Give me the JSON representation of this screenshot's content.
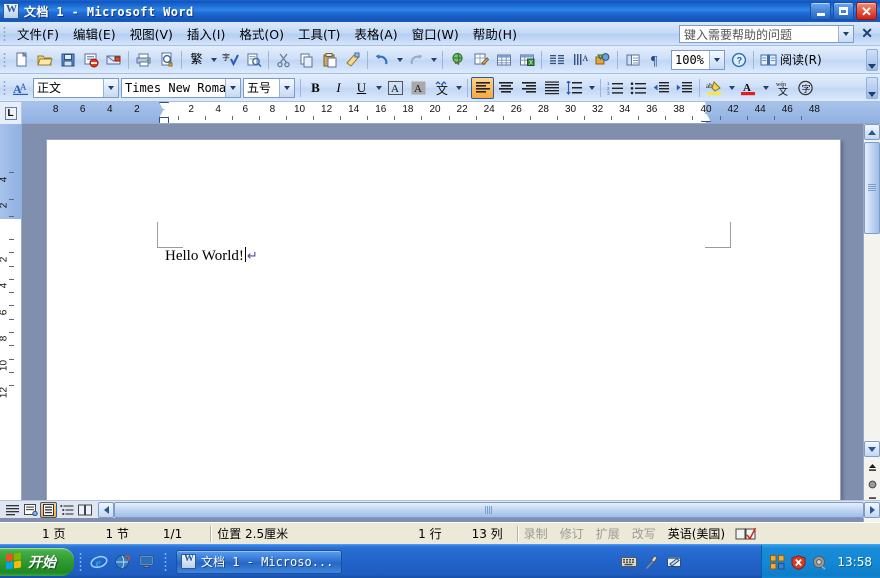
{
  "window": {
    "title": "文档 1 - Microsoft Word",
    "icon": "word-document-icon",
    "minimize_label": "最小化",
    "maximize_label": "最大化",
    "close_label": "关闭"
  },
  "menubar": {
    "items": [
      {
        "label": "文件(F)",
        "name": "menu-file"
      },
      {
        "label": "编辑(E)",
        "name": "menu-edit"
      },
      {
        "label": "视图(V)",
        "name": "menu-view"
      },
      {
        "label": "插入(I)",
        "name": "menu-insert"
      },
      {
        "label": "格式(O)",
        "name": "menu-format"
      },
      {
        "label": "工具(T)",
        "name": "menu-tools"
      },
      {
        "label": "表格(A)",
        "name": "menu-table"
      },
      {
        "label": "窗口(W)",
        "name": "menu-window"
      },
      {
        "label": "帮助(H)",
        "name": "menu-help"
      }
    ],
    "help_box_placeholder": "键入需要帮助的问题",
    "help_box_value": "",
    "close_label": "✕"
  },
  "standard_toolbar": {
    "buttons": [
      {
        "name": "new-document-icon",
        "glyph": "📄",
        "tooltip": "新建空白文档"
      },
      {
        "name": "open-folder-icon",
        "glyph": "📂",
        "tooltip": "打开"
      },
      {
        "name": "save-icon",
        "glyph": "💾",
        "tooltip": "保存"
      },
      {
        "name": "permission-icon",
        "glyph": "🚫",
        "tooltip": "权限"
      },
      {
        "name": "email-icon",
        "glyph": "✉",
        "tooltip": "电子邮件"
      },
      {
        "name": "print-icon",
        "glyph": "🖨",
        "tooltip": "打印"
      },
      {
        "name": "print-preview-icon",
        "glyph": "🔍",
        "tooltip": "打印预览"
      },
      {
        "name": "traditional-chinese-icon",
        "glyph": "繁",
        "tooltip": "简繁转换"
      },
      {
        "name": "spelling-check-icon",
        "glyph": "字",
        "tooltip": "拼写和语法"
      },
      {
        "name": "research-icon",
        "glyph": "📑",
        "tooltip": "信息检索"
      },
      {
        "name": "cut-icon",
        "glyph": "✂",
        "tooltip": "剪切"
      },
      {
        "name": "copy-icon",
        "glyph": "⧉",
        "tooltip": "复制"
      },
      {
        "name": "paste-icon",
        "glyph": "📋",
        "tooltip": "粘贴"
      },
      {
        "name": "format-painter-icon",
        "glyph": "🖌",
        "tooltip": "格式刷"
      },
      {
        "name": "undo-icon",
        "glyph": "↶",
        "tooltip": "撤消"
      },
      {
        "name": "redo-icon",
        "glyph": "↷",
        "tooltip": "恢复"
      },
      {
        "name": "hyperlink-icon",
        "glyph": "🌐",
        "tooltip": "插入超链接"
      },
      {
        "name": "tables-borders-icon",
        "glyph": "▦",
        "tooltip": "表格和边框"
      },
      {
        "name": "insert-table-icon",
        "glyph": "▤",
        "tooltip": "插入表格"
      },
      {
        "name": "insert-excel-icon",
        "glyph": "▩",
        "tooltip": "插入 Excel 电子表格"
      },
      {
        "name": "columns-icon",
        "glyph": "▥",
        "tooltip": "分栏"
      },
      {
        "name": "vertical-text-icon",
        "glyph": "⇅",
        "tooltip": "更改文字方向"
      },
      {
        "name": "drawing-icon",
        "glyph": "◩",
        "tooltip": "绘图"
      },
      {
        "name": "document-map-icon",
        "glyph": "▣",
        "tooltip": "文档结构图"
      },
      {
        "name": "show-hide-marks-icon",
        "glyph": "¶",
        "tooltip": "显示/隐藏编辑标记"
      }
    ],
    "zoom_value": "100%",
    "help_button": "help-icon",
    "reading_label": "阅读(R)",
    "toolbar_options_label": "工具栏选项"
  },
  "formatting_toolbar": {
    "styles_icon": "styles-and-formatting-icon",
    "style_value": "正文",
    "font_value": "Times New Roman",
    "size_value": "五号",
    "buttons": [
      {
        "name": "bold-button",
        "glyph": "B",
        "active": false
      },
      {
        "name": "italic-button",
        "glyph": "I",
        "active": false
      },
      {
        "name": "underline-button",
        "glyph": "U",
        "active": false
      },
      {
        "name": "character-border-button",
        "glyph": "A",
        "active": false
      },
      {
        "name": "character-shading-button",
        "glyph": "A",
        "active": false
      },
      {
        "name": "phonetic-guide-button",
        "glyph": "文",
        "active": false
      },
      {
        "name": "align-left-button",
        "glyph": "≡",
        "active": true
      },
      {
        "name": "align-center-button",
        "glyph": "≡",
        "active": false
      },
      {
        "name": "align-right-button",
        "glyph": "≡",
        "active": false
      },
      {
        "name": "distributed-button",
        "glyph": "≣",
        "active": false
      },
      {
        "name": "line-spacing-button",
        "glyph": "↕",
        "active": false
      },
      {
        "name": "numbered-list-button",
        "glyph": "1.",
        "active": false
      },
      {
        "name": "bulleted-list-button",
        "glyph": "•",
        "active": false
      },
      {
        "name": "decrease-indent-button",
        "glyph": "◀",
        "active": false
      },
      {
        "name": "increase-indent-button",
        "glyph": "▶",
        "active": false
      },
      {
        "name": "highlight-button",
        "glyph": "ab",
        "active": false
      },
      {
        "name": "font-color-button",
        "glyph": "A",
        "active": false
      },
      {
        "name": "translate-button",
        "glyph": "文",
        "active": false
      },
      {
        "name": "enclose-character-button",
        "glyph": "字",
        "active": false
      }
    ],
    "toolbar_options_label": "工具栏选项"
  },
  "ruler": {
    "tab_stop_marker": "L",
    "horizontal_left_numbers": [
      "8",
      "6",
      "4",
      "2"
    ],
    "horizontal_numbers": [
      "2",
      "4",
      "6",
      "8",
      "10",
      "12",
      "14",
      "16",
      "18",
      "20",
      "22",
      "24",
      "26",
      "28",
      "30",
      "32",
      "34",
      "36",
      "38",
      "40",
      "42",
      "44",
      "46",
      "48"
    ],
    "vertical_margin_numbers": [
      "4",
      "2"
    ],
    "vertical_numbers": [
      "2",
      "4",
      "6",
      "8",
      "10",
      "12"
    ],
    "unit": "厘米"
  },
  "document": {
    "text": "Hello World!",
    "paragraph_mark": "↵",
    "cursor_visible": true
  },
  "view_buttons": [
    {
      "name": "normal-view-button",
      "label": "普通视图",
      "active": false
    },
    {
      "name": "web-layout-view-button",
      "label": "Web 版式视图",
      "active": false
    },
    {
      "name": "print-layout-view-button",
      "label": "页面视图",
      "active": true
    },
    {
      "name": "outline-view-button",
      "label": "大纲视图",
      "active": false
    },
    {
      "name": "reading-layout-view-button",
      "label": "阅读版式视图",
      "active": false
    }
  ],
  "statusbar": {
    "page": "1 页",
    "section": "1 节",
    "page_of": "1/1",
    "position": "位置 2.5厘米",
    "line": "1 行",
    "column": "13 列",
    "record": "录制",
    "track_changes": "修订",
    "extend": "扩展",
    "overtype": "改写",
    "language": "英语(美国)",
    "spell_check_icon": "spelling-status-icon"
  },
  "taskbar": {
    "start_label": "开始",
    "quick_launch": [
      {
        "name": "internet-explorer-icon",
        "label": "Internet Explorer"
      },
      {
        "name": "browser-icon",
        "label": "浏览器"
      },
      {
        "name": "show-desktop-icon",
        "label": "显示桌面"
      }
    ],
    "tasks": [
      {
        "name": "taskbar-item-word",
        "label": "文档 1 - Microso...",
        "icon": "word-document-icon",
        "active": true
      }
    ],
    "language_bar": [
      {
        "name": "keyboard-icon",
        "label": "键盘"
      },
      {
        "name": "microphone-icon",
        "label": "话筒"
      },
      {
        "name": "handwriting-icon",
        "label": "手写板"
      }
    ],
    "tray": [
      {
        "name": "network-icon",
        "label": "网络连接"
      },
      {
        "name": "security-shield-icon",
        "label": "安全警报"
      },
      {
        "name": "volume-icon",
        "label": "音量"
      }
    ],
    "time": "13:58"
  },
  "colors": {
    "title_blue": "#1e6ad5",
    "taskbar_blue": "#2163c9",
    "start_green": "#2f9a2f",
    "accent_orange": "#f7a93c",
    "status_bg": "#ece9d8",
    "workarea_gray": "#808fae"
  }
}
